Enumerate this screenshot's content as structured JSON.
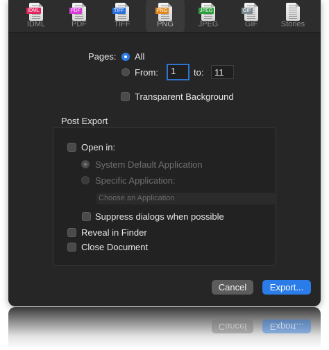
{
  "toolbar": {
    "items": [
      {
        "label": "IDML",
        "tag": "IDML",
        "tag_color": "#e0245e"
      },
      {
        "label": "PDF",
        "tag": "PDF",
        "tag_color": "#d63ad6"
      },
      {
        "label": "TIFF",
        "tag": "TIFF",
        "tag_color": "#2a6fe0"
      },
      {
        "label": "PNG",
        "tag": "PNG",
        "tag_color": "#e08a1e",
        "selected": true
      },
      {
        "label": "JPEG",
        "tag": "JPEG",
        "tag_color": "#2e9e3c"
      },
      {
        "label": "GIF",
        "tag": "GIF",
        "tag_color": "#7d8a90"
      },
      {
        "label": "Stories",
        "tag": "",
        "tag_color": ""
      }
    ]
  },
  "pages": {
    "label": "Pages:",
    "all_label": "All",
    "from_label": "From:",
    "from_value": "1",
    "to_label": "to:",
    "to_value": "11",
    "selected": "All"
  },
  "transparent_background_label": "Transparent Background",
  "post_export": {
    "title": "Post Export",
    "open_in_label": "Open in:",
    "system_default_label": "System Default Application",
    "specific_app_label": "Specific Application:",
    "choose_app_placeholder": "Choose an Application",
    "suppress_dialogs_label": "Suppress dialogs when possible",
    "reveal_in_finder_label": "Reveal in Finder",
    "close_document_label": "Close Document"
  },
  "buttons": {
    "cancel": "Cancel",
    "export": "Export..."
  },
  "colors": {
    "accent": "#2a7ce8",
    "dialog_bg": "#262626"
  }
}
